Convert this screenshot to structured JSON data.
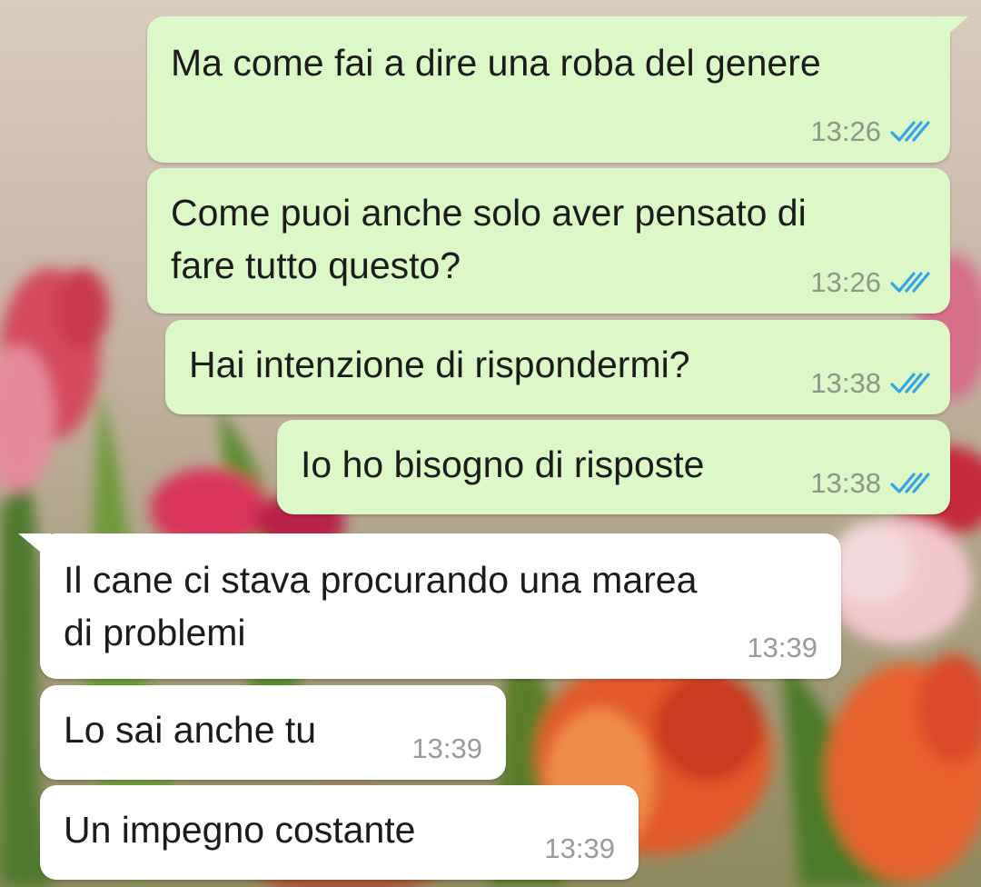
{
  "conversation": {
    "messages": [
      {
        "direction": "outgoing",
        "text": "Ma come fai a dire una roba del genere",
        "time": "13:26",
        "status": "read"
      },
      {
        "direction": "outgoing",
        "text": "Come puoi anche solo aver pensato di\nfare tutto questo?",
        "time": "13:26",
        "status": "read"
      },
      {
        "direction": "outgoing",
        "text": "Hai intenzione di rispondermi?",
        "time": "13:38",
        "status": "read"
      },
      {
        "direction": "outgoing",
        "text": "Io ho bisogno di risposte",
        "time": "13:38",
        "status": "read"
      },
      {
        "direction": "incoming",
        "text": "Il cane ci stava procurando una marea\ndi problemi",
        "time": "13:39"
      },
      {
        "direction": "incoming",
        "text": "Lo sai anche tu",
        "time": "13:39"
      },
      {
        "direction": "incoming",
        "text": "Un impegno costante",
        "time": "13:39"
      }
    ]
  },
  "icons": {
    "read_receipt": "double-check-icon",
    "bubble_tail": "bubble-tail-icon"
  },
  "colors": {
    "outgoing_bubble": "#dcf8c6",
    "incoming_bubble": "#ffffff",
    "read_tick": "#34a3e6",
    "timestamp": "#8c978a"
  }
}
